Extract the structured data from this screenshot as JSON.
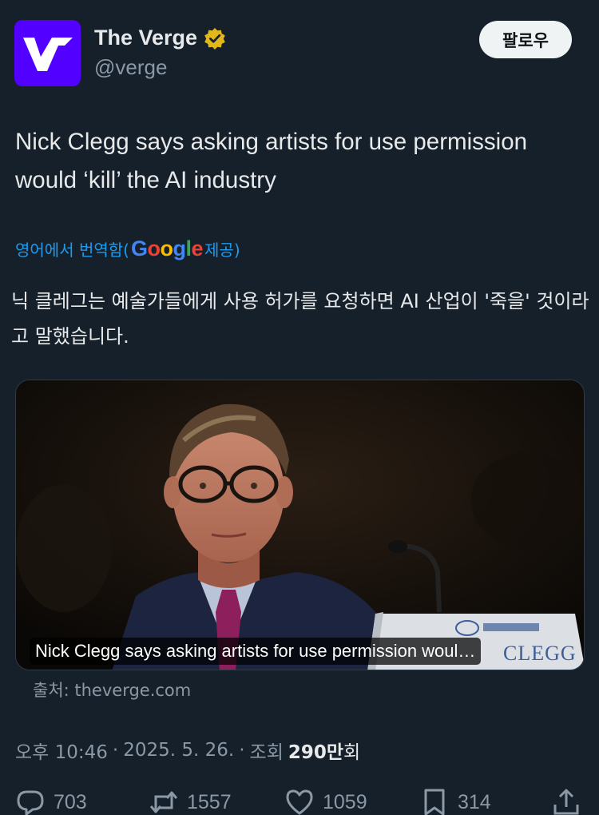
{
  "author": {
    "display_name": "The Verge",
    "handle": "@verge",
    "verified": true,
    "avatar_color": "#5200ff"
  },
  "follow_label": "팔로우",
  "tweet_text": "Nick Clegg says asking artists for use permission would ‘kill’ the AI industry",
  "translation": {
    "prefix": "영어에서 번역함(",
    "google": [
      "G",
      "o",
      "o",
      "g",
      "l",
      "e"
    ],
    "suffix": " 제공)",
    "text": "닉 클레그는 예술가들에게 사용 허가를 요청하면 AI 산업이 '죽을' 것이라고 말했습니다."
  },
  "card": {
    "caption": "Nick Clegg says asking artists for use permission woul…",
    "source": "출처: theverge.com"
  },
  "meta": {
    "time": "오후 10:46",
    "date": "2025. 5. 26.",
    "views_label": "조회",
    "views_count": "290만",
    "views_unit": "회"
  },
  "actions": {
    "replies": "703",
    "reposts": "1557",
    "likes": "1059",
    "bookmarks": "314"
  },
  "colors": {
    "background": "#15202b",
    "link": "#1d9bf0",
    "secondary_text": "#8b98a5",
    "verified_gold": "#e2b719"
  }
}
